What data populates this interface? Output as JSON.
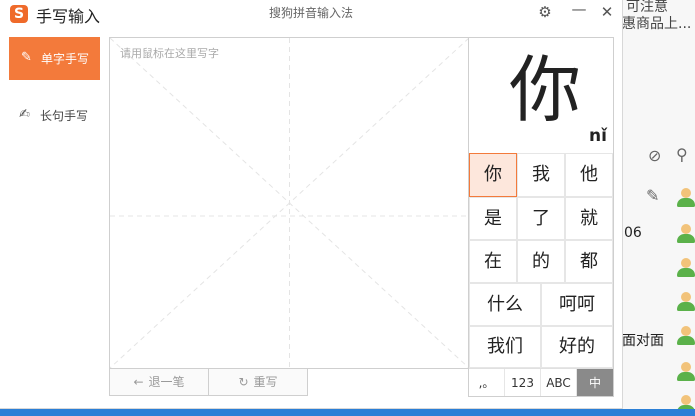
{
  "window": {
    "title": "手写输入",
    "logo_letter": "S",
    "subtitle": "搜狗拼音输入法",
    "settings_icon": "gear-icon",
    "minimize_icon": "minimize-icon",
    "close_icon": "close-icon"
  },
  "sidebar": {
    "items": [
      {
        "label": "单字手写",
        "icon": "pen-square-icon",
        "active": true
      },
      {
        "label": "长句手写",
        "icon": "pen-lines-icon",
        "active": false
      }
    ]
  },
  "pad": {
    "placeholder": "请用鼠标在这里写字",
    "undo_label": "退一笔",
    "rewrite_label": "重写"
  },
  "candidates": {
    "preview_char": "你",
    "preview_pinyin": "nǐ",
    "rows": [
      [
        "你",
        "我",
        "他"
      ],
      [
        "是",
        "了",
        "就"
      ],
      [
        "在",
        "的",
        "都"
      ],
      [
        "什么",
        "呵呵"
      ],
      [
        "我们",
        "好的"
      ]
    ],
    "selected": "你"
  },
  "input_modes": [
    {
      "label": ",。",
      "active": false
    },
    {
      "label": "123",
      "active": false
    },
    {
      "label": "ABC",
      "active": false
    },
    {
      "label": "中",
      "active": true
    }
  ],
  "background_app": {
    "text_top_1": "可注意",
    "text_top_2": "惠商品上...",
    "text_mid": "06",
    "text_bottom": "面对面"
  },
  "colors": {
    "accent": "#f37a3b",
    "selected_bg": "#fde7dc",
    "taskbar": "#2b7fd6"
  }
}
